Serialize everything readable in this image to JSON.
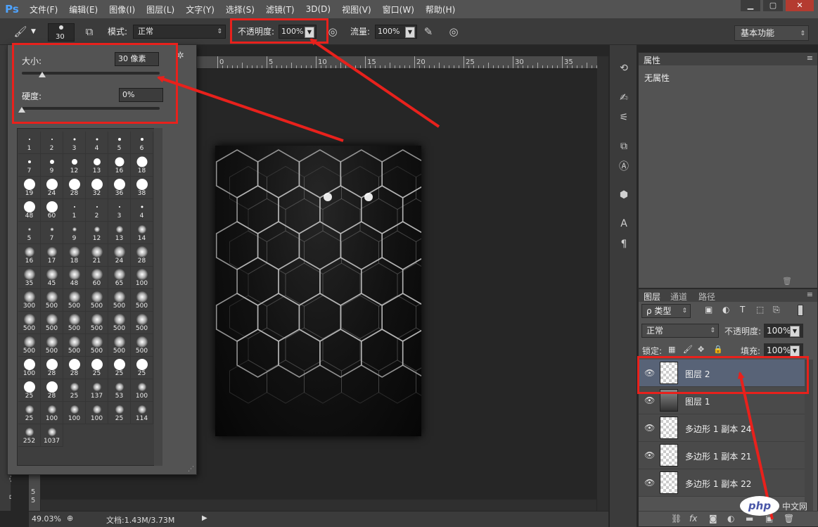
{
  "app": {
    "logo": "Ps"
  },
  "menu": [
    "文件(F)",
    "编辑(E)",
    "图像(I)",
    "图层(L)",
    "文字(Y)",
    "选择(S)",
    "滤镜(T)",
    "3D(D)",
    "视图(V)",
    "窗口(W)",
    "帮助(H)"
  ],
  "window_controls": {
    "minimize": "▁",
    "maximize": "▢",
    "close": "✕"
  },
  "options": {
    "brush_size": "30",
    "mode_label": "模式:",
    "mode_value": "正常",
    "opacity_label": "不透明度:",
    "opacity_value": "100%",
    "flow_label": "流量:",
    "flow_value": "100%",
    "workspace": "基本功能"
  },
  "brush_panel": {
    "size_label": "大小:",
    "size_value": "30 像素",
    "size_fraction": 0.15,
    "hardness_label": "硬度:",
    "hardness_value": "0%",
    "hardness_fraction": 0.0,
    "presets": [
      {
        "n": "1",
        "s": 2,
        "soft": false
      },
      {
        "n": "2",
        "s": 2,
        "soft": false
      },
      {
        "n": "3",
        "s": 3,
        "soft": false
      },
      {
        "n": "4",
        "s": 3,
        "soft": false
      },
      {
        "n": "5",
        "s": 4,
        "soft": false
      },
      {
        "n": "6",
        "s": 4,
        "soft": false
      },
      {
        "n": "7",
        "s": 4,
        "soft": false
      },
      {
        "n": "9",
        "s": 6,
        "soft": false
      },
      {
        "n": "12",
        "s": 8,
        "soft": false
      },
      {
        "n": "13",
        "s": 10,
        "soft": false
      },
      {
        "n": "16",
        "s": 13,
        "soft": false
      },
      {
        "n": "18",
        "s": 15,
        "soft": false
      },
      {
        "n": "19",
        "s": 16,
        "soft": false
      },
      {
        "n": "24",
        "s": 16,
        "soft": false
      },
      {
        "n": "28",
        "s": 16,
        "soft": false
      },
      {
        "n": "32",
        "s": 16,
        "soft": false
      },
      {
        "n": "36",
        "s": 16,
        "soft": false
      },
      {
        "n": "38",
        "s": 16,
        "soft": false
      },
      {
        "n": "48",
        "s": 16,
        "soft": false
      },
      {
        "n": "60",
        "s": 16,
        "soft": false
      },
      {
        "n": "1",
        "s": 2,
        "soft": false
      },
      {
        "n": "2",
        "s": 2,
        "soft": false
      },
      {
        "n": "3",
        "s": 2,
        "soft": false
      },
      {
        "n": "4",
        "s": 3,
        "soft": false
      },
      {
        "n": "5",
        "s": 4,
        "soft": true
      },
      {
        "n": "7",
        "s": 5,
        "soft": true
      },
      {
        "n": "9",
        "s": 6,
        "soft": true
      },
      {
        "n": "12",
        "s": 8,
        "soft": true
      },
      {
        "n": "13",
        "s": 10,
        "soft": true
      },
      {
        "n": "14",
        "s": 12,
        "soft": true
      },
      {
        "n": "16",
        "s": 14,
        "soft": true
      },
      {
        "n": "17",
        "s": 14,
        "soft": true
      },
      {
        "n": "18",
        "s": 15,
        "soft": true
      },
      {
        "n": "21",
        "s": 16,
        "soft": true
      },
      {
        "n": "24",
        "s": 16,
        "soft": true
      },
      {
        "n": "28",
        "s": 16,
        "soft": true
      },
      {
        "n": "35",
        "s": 16,
        "soft": true
      },
      {
        "n": "45",
        "s": 16,
        "soft": true
      },
      {
        "n": "48",
        "s": 16,
        "soft": true
      },
      {
        "n": "60",
        "s": 16,
        "soft": true
      },
      {
        "n": "65",
        "s": 16,
        "soft": true
      },
      {
        "n": "100",
        "s": 16,
        "soft": true
      },
      {
        "n": "300",
        "s": 16,
        "soft": true
      },
      {
        "n": "500",
        "s": 16,
        "soft": true
      },
      {
        "n": "500",
        "s": 16,
        "soft": true
      },
      {
        "n": "500",
        "s": 16,
        "soft": true
      },
      {
        "n": "500",
        "s": 16,
        "soft": true
      },
      {
        "n": "500",
        "s": 16,
        "soft": true
      },
      {
        "n": "500",
        "s": 16,
        "soft": true
      },
      {
        "n": "500",
        "s": 16,
        "soft": true
      },
      {
        "n": "500",
        "s": 16,
        "soft": true
      },
      {
        "n": "500",
        "s": 16,
        "soft": true
      },
      {
        "n": "500",
        "s": 16,
        "soft": true
      },
      {
        "n": "500",
        "s": 16,
        "soft": true
      },
      {
        "n": "500",
        "s": 16,
        "soft": true
      },
      {
        "n": "500",
        "s": 16,
        "soft": true
      },
      {
        "n": "500",
        "s": 16,
        "soft": true
      },
      {
        "n": "500",
        "s": 16,
        "soft": true
      },
      {
        "n": "500",
        "s": 16,
        "soft": true
      },
      {
        "n": "500",
        "s": 16,
        "soft": true
      },
      {
        "n": "100",
        "s": 16,
        "soft": false
      },
      {
        "n": "28",
        "s": 16,
        "soft": false
      },
      {
        "n": "28",
        "s": 16,
        "soft": false
      },
      {
        "n": "25",
        "s": 16,
        "soft": false
      },
      {
        "n": "25",
        "s": 16,
        "soft": false
      },
      {
        "n": "25",
        "s": 16,
        "soft": false
      },
      {
        "n": "25",
        "s": 16,
        "soft": false
      },
      {
        "n": "28",
        "s": 16,
        "soft": false
      },
      {
        "n": "25",
        "s": 12,
        "soft": true
      },
      {
        "n": "137",
        "s": 12,
        "soft": true
      },
      {
        "n": "53",
        "s": 12,
        "soft": true
      },
      {
        "n": "100",
        "s": 12,
        "soft": true
      },
      {
        "n": "25",
        "s": 12,
        "soft": true
      },
      {
        "n": "100",
        "s": 12,
        "soft": true
      },
      {
        "n": "100",
        "s": 12,
        "soft": true
      },
      {
        "n": "100",
        "s": 12,
        "soft": true
      },
      {
        "n": "25",
        "s": 12,
        "soft": true
      },
      {
        "n": "114",
        "s": 12,
        "soft": true
      },
      {
        "n": "252",
        "s": 12,
        "soft": true
      },
      {
        "n": "1037",
        "s": 12,
        "soft": true
      }
    ]
  },
  "ruler": {
    "h_labels": [
      "0",
      "5",
      "10",
      "15",
      "20",
      "25",
      "30",
      "35"
    ],
    "v_labels": [
      "3",
      "5",
      "5"
    ]
  },
  "status": {
    "zoom": "49.03%",
    "doc": "文档:1.43M/3.73M"
  },
  "properties_panel": {
    "tab": "属性",
    "content": "无属性"
  },
  "layers_panel": {
    "tabs": [
      "图层",
      "通道",
      "路径"
    ],
    "filter": "ρ 类型",
    "blend_mode": "正常",
    "opacity_label": "不透明度:",
    "opacity_value": "100%",
    "lock_label": "锁定:",
    "fill_label": "填充:",
    "fill_value": "100%",
    "layers": [
      {
        "name": "图层 2",
        "selected": true,
        "thumb": "transparent"
      },
      {
        "name": "图层 1",
        "selected": false,
        "thumb": "dark"
      },
      {
        "name": "多边形 1 副本 24",
        "selected": false,
        "thumb": "transparent"
      },
      {
        "name": "多边形 1 副本 21",
        "selected": false,
        "thumb": "transparent"
      },
      {
        "name": "多边形 1 副本 22",
        "selected": false,
        "thumb": "transparent"
      }
    ]
  },
  "watermark": {
    "logo": "php",
    "text": "中文网"
  },
  "annotation_color": "#e8211c"
}
